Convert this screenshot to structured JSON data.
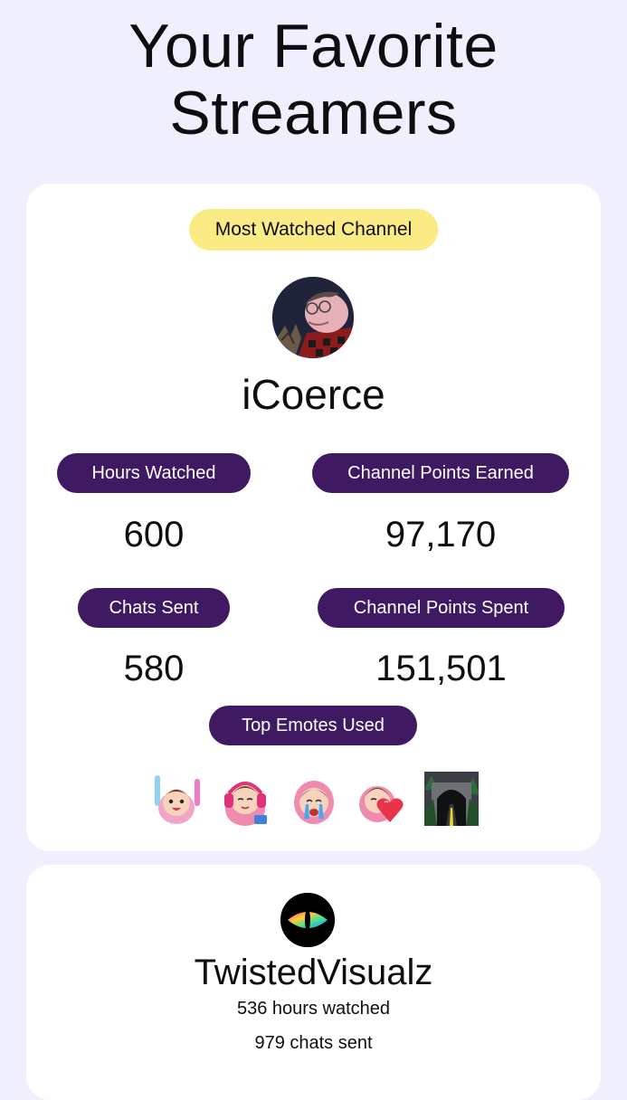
{
  "page": {
    "title_line1": "Your Favorite",
    "title_line2": "Streamers"
  },
  "top_channel": {
    "tag": "Most Watched Channel",
    "name": "iCoerce",
    "stats": [
      {
        "label": "Hours Watched",
        "value": "600"
      },
      {
        "label": "Channel Points Earned",
        "value": "97,170"
      },
      {
        "label": "Chats Sent",
        "value": "580"
      },
      {
        "label": "Channel Points Spent",
        "value": "151,501"
      }
    ],
    "emotes_label": "Top Emotes Used",
    "emotes": [
      "emote-rave-icon",
      "emote-headphones-icon",
      "emote-crying-icon",
      "emote-heart-icon",
      "emote-tunnel-icon"
    ]
  },
  "second_channel": {
    "name": "TwistedVisualz",
    "hours": "536 hours watched",
    "chats": "979 chats sent"
  },
  "colors": {
    "background": "#f0effd",
    "pill": "#3f1a63",
    "tag": "#fbeb84",
    "card": "#ffffff"
  }
}
